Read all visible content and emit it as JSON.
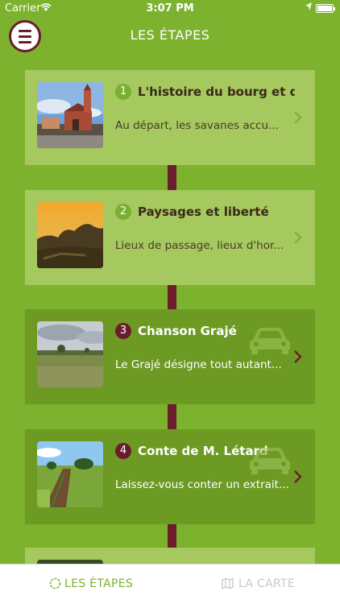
{
  "status_bar": {
    "carrier": "Carrier",
    "time": "3:07 PM"
  },
  "header": {
    "title": "LES ÉTAPES",
    "menu_icon": "hamburger-menu-icon"
  },
  "colors": {
    "background": "#7cb22d",
    "card_light": "#a5c85f",
    "card_dark": "#6d9a23",
    "accent": "#6b1d2d",
    "tab_active": "#7cb22d",
    "tab_inactive": "#c9c9c9"
  },
  "steps": [
    {
      "number": "1",
      "title": "L'histoire du bourg et d...",
      "description": "Au départ, les savanes accu...",
      "style": "light",
      "image": "church-photo"
    },
    {
      "number": "2",
      "title": "Paysages et liberté",
      "description": "Lieux de passage, lieux d'hor...",
      "style": "light",
      "image": "sunset-landscape-photo"
    },
    {
      "number": "3",
      "title": "Chanson Grajé",
      "description": "Le Grajé désigne tout autant...",
      "style": "dark",
      "image": "savanna-photo",
      "badge_icon": "car-icon"
    },
    {
      "number": "4",
      "title": "Conte de M. Létard",
      "description": "Laissez-vous conter un extrait...",
      "style": "dark",
      "image": "field-path-photo",
      "badge_icon": "car-icon"
    }
  ],
  "tabs": [
    {
      "label": "LES ÉTAPES",
      "icon": "circle-icon",
      "active": true
    },
    {
      "label": "LA CARTE",
      "icon": "map-icon",
      "active": false
    }
  ]
}
